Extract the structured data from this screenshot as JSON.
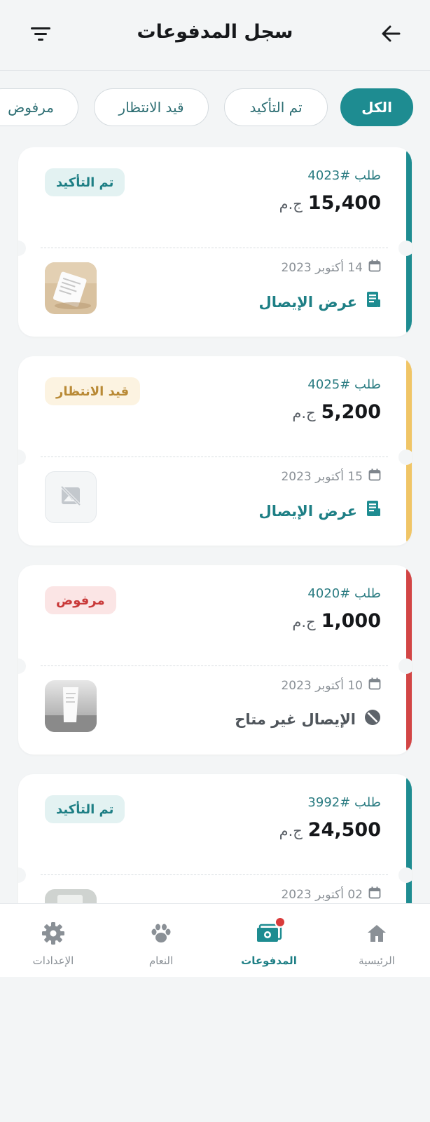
{
  "header": {
    "title": "سجل المدفوعات"
  },
  "filters": [
    {
      "label": "الكل",
      "active": true
    },
    {
      "label": "تم التأكيد",
      "active": false
    },
    {
      "label": "قيد الانتظار",
      "active": false
    },
    {
      "label": "مرفوض",
      "active": false
    }
  ],
  "payments": [
    {
      "order": "طلب #4023",
      "amount": "15,400",
      "currency": "ج.م",
      "status": "تم التأكيد",
      "date": "14 أكتوبر 2023",
      "action": "عرض الإيصال",
      "stripe_color": "#1e8c91"
    },
    {
      "order": "طلب #4025",
      "amount": "5,200",
      "currency": "ج.م",
      "status": "قيد الانتظار",
      "date": "15 أكتوبر 2023",
      "action": "عرض الإيصال",
      "stripe_color": "#f0c566"
    },
    {
      "order": "طلب #4020",
      "amount": "1,000",
      "currency": "ج.م",
      "status": "مرفوض",
      "date": "10 أكتوبر 2023",
      "action": "الإيصال غير متاح",
      "stripe_color": "#d24545"
    },
    {
      "order": "طلب #3992",
      "amount": "24,500",
      "currency": "ج.م",
      "status": "تم التأكيد",
      "date": "02 أكتوبر 2023",
      "stripe_color": "#1e8c91"
    }
  ],
  "nav": [
    {
      "label": "الرئيسية",
      "icon": "home-icon"
    },
    {
      "label": "المدفوعات",
      "icon": "payments-icon",
      "active": true
    },
    {
      "label": "النعام",
      "icon": "paw-icon"
    },
    {
      "label": "الإعدادات",
      "icon": "gear-icon"
    }
  ],
  "colors": {
    "accent": "#1e8c91",
    "pending": "#f0c566",
    "rejected": "#d24545",
    "badge_dot": "#d93b3b"
  }
}
